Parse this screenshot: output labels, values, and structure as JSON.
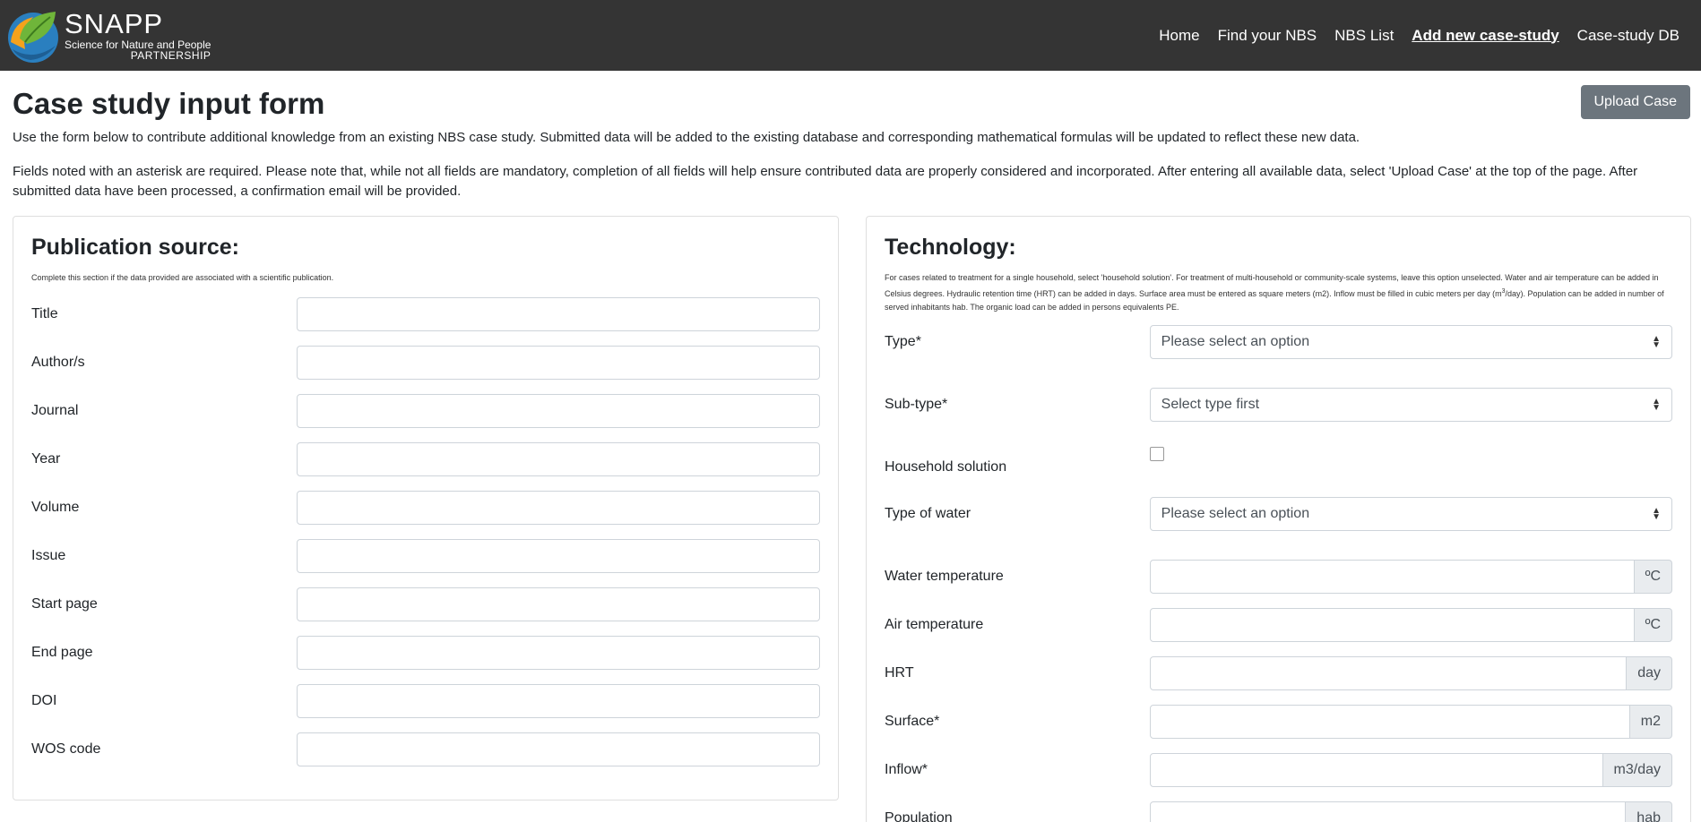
{
  "brand": {
    "name": "SNAPP",
    "tagline": "Science for Nature and People",
    "tagline2": "PARTNERSHIP"
  },
  "nav": [
    {
      "label": "Home"
    },
    {
      "label": "Find your NBS"
    },
    {
      "label": "NBS List"
    },
    {
      "label": "Add new case-study"
    },
    {
      "label": "Case-study DB"
    }
  ],
  "page": {
    "title": "Case study input form",
    "upload_label": "Upload Case",
    "intro": "Use the form below to contribute additional knowledge from an existing NBS case study. Submitted data will be added to the existing database and corresponding mathematical formulas will be updated to reflect these new data.",
    "instructions": "Fields noted with an asterisk are required. Please note that, while not all fields are mandatory, completion of all fields will help ensure contributed data are properly considered and incorporated. After entering all available data, select 'Upload Case' at the top of the page. After submitted data have been processed, a confirmation email will be provided."
  },
  "publication": {
    "title": "Publication source:",
    "note": "Complete this section if the data provided are associated with a scientific publication.",
    "fields": [
      {
        "label": "Title",
        "value": ""
      },
      {
        "label": "Author/s",
        "value": ""
      },
      {
        "label": "Journal",
        "value": ""
      },
      {
        "label": "Year",
        "value": ""
      },
      {
        "label": "Volume",
        "value": ""
      },
      {
        "label": "Issue",
        "value": ""
      },
      {
        "label": "Start page",
        "value": ""
      },
      {
        "label": "End page",
        "value": ""
      },
      {
        "label": "DOI",
        "value": ""
      },
      {
        "label": "WOS code",
        "value": ""
      }
    ]
  },
  "technology": {
    "title": "Technology:",
    "note_a": "For cases related to treatment for a single household, select 'household solution'. For treatment of multi-household or community-scale systems, leave this option unselected. Water and air temperature can be added in Celsius degrees. Hydraulic retention time (HRT) can be added in days. Surface area must be entered as square meters (m2). Inflow must be filled in cubic meters per day (m",
    "note_sup": "3",
    "note_b": "/day). Population can be added in number of served inhabitants hab. The organic load can be added in persons equivalents PE.",
    "type": {
      "label": "Type*",
      "selected": "Please select an option"
    },
    "subtype": {
      "label": "Sub-type*",
      "selected": "Select type first"
    },
    "household": {
      "label": "Household solution",
      "checked": false
    },
    "water_type": {
      "label": "Type of water",
      "selected": "Please select an option"
    },
    "water_temp": {
      "label": "Water temperature",
      "unit": "ºC",
      "value": ""
    },
    "air_temp": {
      "label": "Air temperature",
      "unit": "ºC",
      "value": ""
    },
    "hrt": {
      "label": "HRT",
      "unit": "day",
      "value": ""
    },
    "surface": {
      "label": "Surface*",
      "unit": "m2",
      "value": ""
    },
    "inflow": {
      "label": "Inflow*",
      "unit": "m3/day",
      "value": ""
    },
    "population": {
      "label": "Population",
      "unit": "hab",
      "value": ""
    }
  },
  "colors": {
    "navbar": "#343434",
    "button": "#6c757d",
    "logo_blue": "#2a7fbf",
    "logo_green": "#6fb53a",
    "logo_orange": "#f5a21c"
  }
}
